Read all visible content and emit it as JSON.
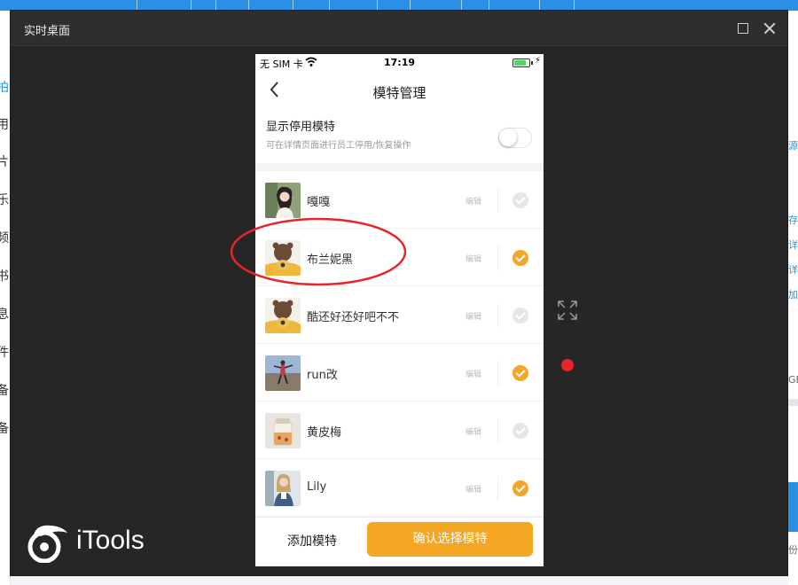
{
  "window": {
    "title": "实时桌面"
  },
  "background_app": {
    "left_nav": [
      "拍",
      "用",
      "片",
      "乐",
      "频",
      "书",
      "息",
      "件",
      "备",
      "备"
    ],
    "right_links": [
      "源",
      "存",
      "详",
      "详",
      "加"
    ],
    "right_misc": [
      "GB",
      "份"
    ]
  },
  "phone": {
    "status_bar": {
      "carrier": "无 SIM 卡",
      "time": "17:19",
      "battery_level": 0.8
    },
    "nav": {
      "title": "模特管理"
    },
    "toggle": {
      "title": "显示停用模特",
      "subtitle": "可在详情页面进行员工停用/恢复操作",
      "enabled": false
    },
    "edit_label": "编辑",
    "models": [
      {
        "name": "嘎嘎",
        "selected": false
      },
      {
        "name": "布兰妮黑",
        "selected": true
      },
      {
        "name": "酷还好还好吧不不",
        "selected": false
      },
      {
        "name": "run改",
        "selected": true
      },
      {
        "name": "黄皮梅",
        "selected": false
      },
      {
        "name": "Lily",
        "selected": true
      }
    ],
    "bottom": {
      "add_label": "添加模特",
      "confirm_label": "确认选择模特"
    }
  },
  "logo": {
    "text": "iTools"
  },
  "colors": {
    "accent": "#f5a623",
    "annotation": "#e6262b",
    "window_bg": "#262626",
    "app_blue": "#2b8fe6"
  }
}
